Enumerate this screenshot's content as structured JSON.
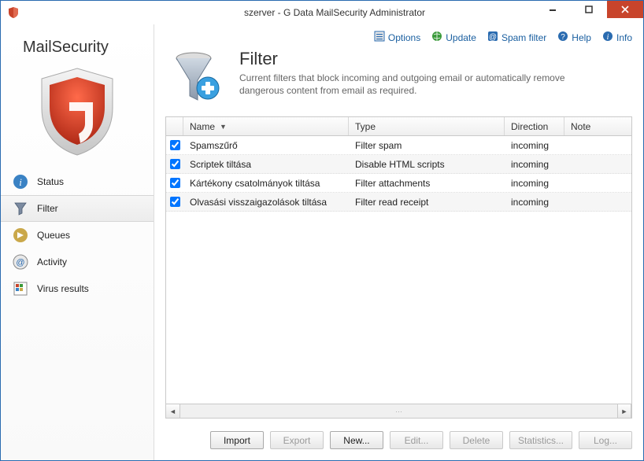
{
  "window": {
    "title": "szerver - G Data MailSecurity Administrator"
  },
  "toolbar": {
    "options": "Options",
    "update": "Update",
    "spamfilter": "Spam filter",
    "help": "Help",
    "info": "Info"
  },
  "sidebar": {
    "brand": "MailSecurity",
    "items": [
      {
        "label": "Status"
      },
      {
        "label": "Filter"
      },
      {
        "label": "Queues"
      },
      {
        "label": "Activity"
      },
      {
        "label": "Virus results"
      }
    ]
  },
  "header": {
    "title": "Filter",
    "description": "Current filters that block incoming and outgoing email or automatically remove dangerous content from email as required."
  },
  "table": {
    "columns": {
      "name": "Name",
      "type": "Type",
      "direction": "Direction",
      "note": "Note"
    },
    "rows": [
      {
        "checked": true,
        "name": "Spamszűrő",
        "type": "Filter spam",
        "direction": "incoming",
        "note": ""
      },
      {
        "checked": true,
        "name": "Scriptek tiltása",
        "type": "Disable HTML scripts",
        "direction": "incoming",
        "note": ""
      },
      {
        "checked": true,
        "name": "Kártékony csatolmányok tiltása",
        "type": "Filter attachments",
        "direction": "incoming",
        "note": ""
      },
      {
        "checked": true,
        "name": "Olvasási visszaigazolások tiltása",
        "type": "Filter read receipt",
        "direction": "incoming",
        "note": ""
      }
    ]
  },
  "buttons": {
    "import": "Import",
    "export": "Export",
    "new": "New...",
    "edit": "Edit...",
    "delete": "Delete",
    "statistics": "Statistics...",
    "log": "Log..."
  }
}
